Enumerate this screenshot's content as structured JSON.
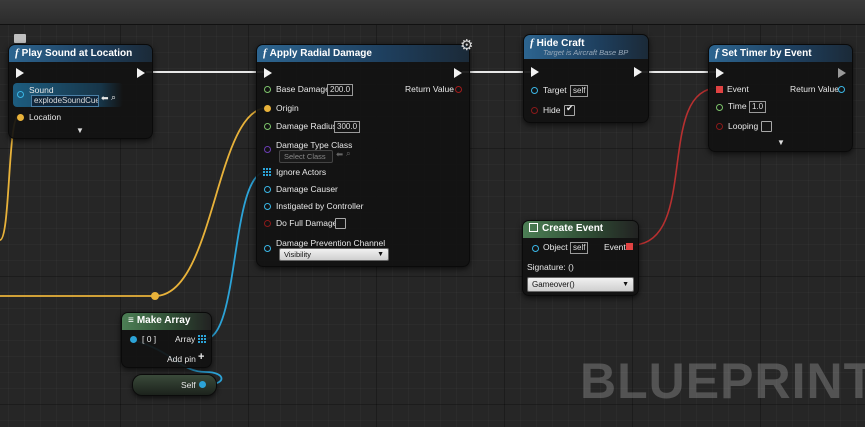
{
  "watermark": "BLUEPRINT",
  "colors": {
    "exec": "#f2f2f2",
    "object_pin": "#2ca3d7",
    "vector_pin": "#e8b23a",
    "float_pin": "#7dc46b",
    "bool_pin": "#a21c1c",
    "class_pin": "#6b3db4",
    "event_pin": "#e04242",
    "function_header": "#2d6590",
    "array_header": "#4c7f55"
  },
  "nodes": {
    "play_sound": {
      "title": "Play Sound at Location",
      "sound_label": "Sound",
      "sound_value": "explodeSoundCue",
      "location_label": "Location"
    },
    "radial": {
      "title": "Apply Radial Damage",
      "base_damage_label": "Base Damage",
      "base_damage_value": "200.0",
      "return_value_label": "Return Value",
      "origin_label": "Origin",
      "radius_label": "Damage Radius",
      "radius_value": "300.0",
      "type_class_label": "Damage Type Class",
      "type_class_value": "Select Class",
      "ignore_actors_label": "Ignore Actors",
      "causer_label": "Damage Causer",
      "instigated_label": "Instigated by Controller",
      "full_damage_label": "Do Full Damage",
      "prevention_label": "Damage Prevention Channel",
      "prevention_value": "Visibility"
    },
    "hide_craft": {
      "title": "Hide Craft",
      "subtitle": "Target is Aircraft Base BP",
      "target_label": "Target",
      "target_value": "self",
      "hide_label": "Hide"
    },
    "set_timer": {
      "title": "Set Timer by Event",
      "event_label": "Event",
      "return_value_label": "Return Value",
      "time_label": "Time",
      "time_value": "1.0",
      "looping_label": "Looping"
    },
    "create_event": {
      "title": "Create Event",
      "object_label": "Object",
      "object_value": "self",
      "event_label": "Event",
      "signature_label": "Signature: ()",
      "function_value": "Gameover()"
    },
    "make_array": {
      "title": "Make Array",
      "index_label": "[ 0 ]",
      "array_label": "Array",
      "add_pin_label": "Add pin"
    },
    "self_node": {
      "label": "Self"
    }
  }
}
